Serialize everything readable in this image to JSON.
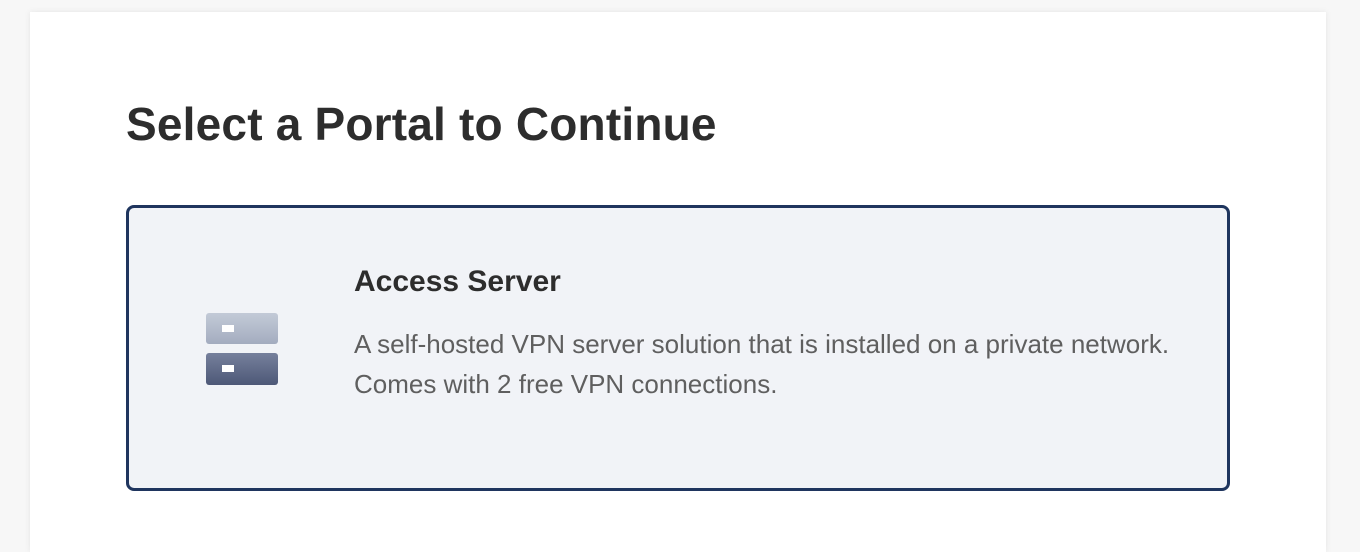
{
  "page": {
    "title": "Select a Portal to Continue"
  },
  "portals": [
    {
      "title": "Access Server",
      "description_line_1": "A self-hosted VPN server solution that is installed on a private network.",
      "description_line_2": "Comes with 2 free VPN connections.",
      "icon": "server-icon"
    }
  ],
  "colors": {
    "card_border": "#1f355e",
    "card_background": "#f1f3f7",
    "icon_top": "#b4bccb",
    "icon_bottom": "#5d6886"
  }
}
